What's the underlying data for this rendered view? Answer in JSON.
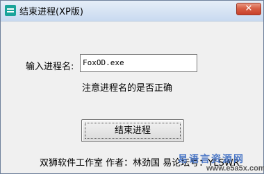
{
  "window": {
    "title": "结束进程(XP版)",
    "close_glyph": "✕"
  },
  "form": {
    "input_label": "输入进程名:",
    "input_value": "FoxOD.exe",
    "hint": "注意进程名的是否正确",
    "submit_label": "结束进程"
  },
  "footer": {
    "credits": "双狮软件工作室   作者：林劲国 易论坛号：YLSWR"
  },
  "watermark": {
    "title": "易语言资源网",
    "url": "www.e5a5x.com"
  },
  "colors": {
    "close_button": "#d75f45",
    "titlebar": "#d6e3f3",
    "watermark": "#4472c4"
  }
}
